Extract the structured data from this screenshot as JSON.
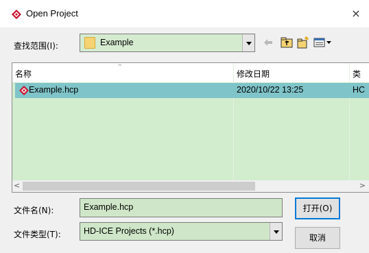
{
  "window": {
    "title": "Open Project",
    "close_glyph": "×",
    "icon": "hd-ice-diamond-icon"
  },
  "lookin": {
    "label": "查找范围(I):",
    "value": "Example"
  },
  "toolbar": {
    "icons": [
      "back-arrow-icon",
      "up-folder-icon",
      "new-folder-icon",
      "view-menu-icon"
    ]
  },
  "list": {
    "columns": [
      "名称",
      "修改日期",
      "类"
    ],
    "sort_indicator": "^",
    "rows": [
      {
        "name": "Example.hcp",
        "date": "2020/10/22 13:25",
        "type": "HC"
      }
    ]
  },
  "scroll": {
    "left": "<",
    "right": ">"
  },
  "filename": {
    "label": "文件名(N):",
    "value": "Example.hcp"
  },
  "filetype": {
    "label": "文件类型(T):",
    "value": "HD-ICE Projects (*.hcp)"
  },
  "buttons": {
    "open": "打开(O)",
    "cancel": "取消"
  },
  "colors": {
    "field_bg": "#d2ecce",
    "selection": "#7fc4c9",
    "icon_red": "#c8102e"
  }
}
